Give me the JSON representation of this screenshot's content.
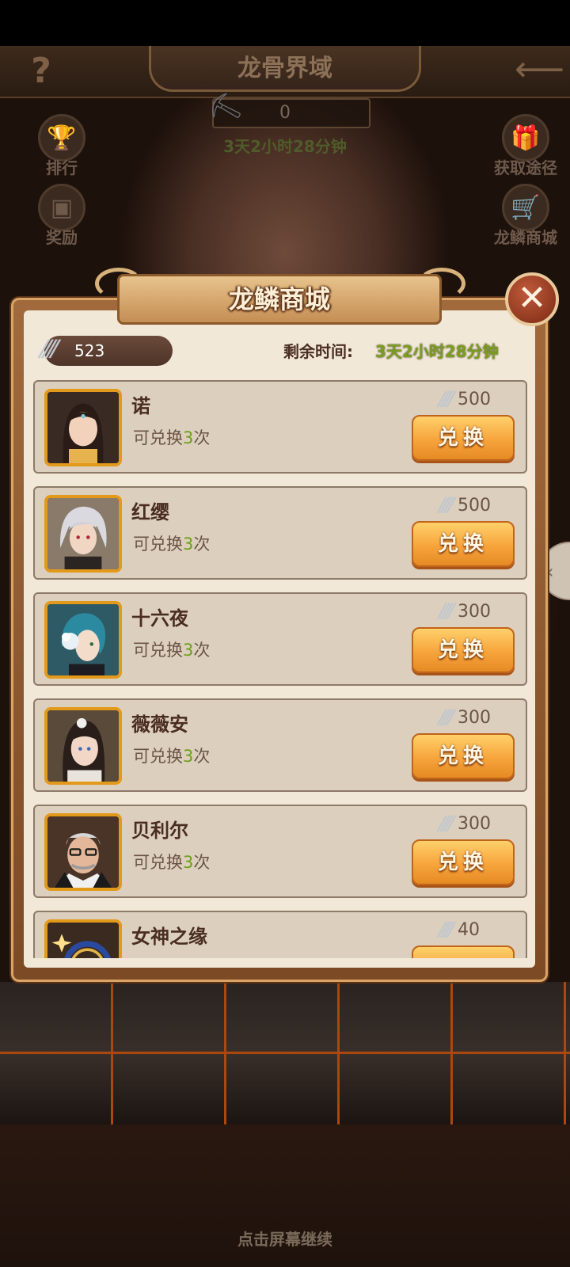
{
  "scene": {
    "title": "龙骨界域",
    "currency_value": "0",
    "timer": "3天2小时28分钟",
    "left_buttons": [
      {
        "label": "排行",
        "icon": "trophy-icon"
      },
      {
        "label": "奖励",
        "icon": "gift-box-icon"
      }
    ],
    "right_buttons": [
      {
        "label": "获取途径",
        "icon": "gift-icon"
      },
      {
        "label": "龙鳞商城",
        "icon": "cart-icon"
      }
    ],
    "continue_hint": "点击屏幕继续"
  },
  "shop": {
    "title": "龙鳞商城",
    "balance": "523",
    "remain_label": "剩余时间:",
    "remain_value": "3天2小时28分钟",
    "exchange_label": "兑换",
    "limit_prefix": "可兑换",
    "limit_suffix": "次",
    "items": [
      {
        "name": "诺",
        "limit": "3",
        "price": "500",
        "exchange": "兑换"
      },
      {
        "name": "红缨",
        "limit": "3",
        "price": "500",
        "exchange": "兑换"
      },
      {
        "name": "十六夜",
        "limit": "3",
        "price": "300",
        "exchange": "兑换"
      },
      {
        "name": "薇薇安",
        "limit": "3",
        "price": "300",
        "exchange": "兑换"
      },
      {
        "name": "贝利尔",
        "limit": "3",
        "price": "300",
        "exchange": "兑换"
      },
      {
        "name": "女神之缘",
        "limit": "",
        "price": "40",
        "exchange": ""
      }
    ]
  },
  "colors": {
    "accent_orange": "#f7a43c",
    "limit_green": "#6aa018",
    "timer_green": "#7a9e1e",
    "portrait_border": "#e39a1a"
  }
}
